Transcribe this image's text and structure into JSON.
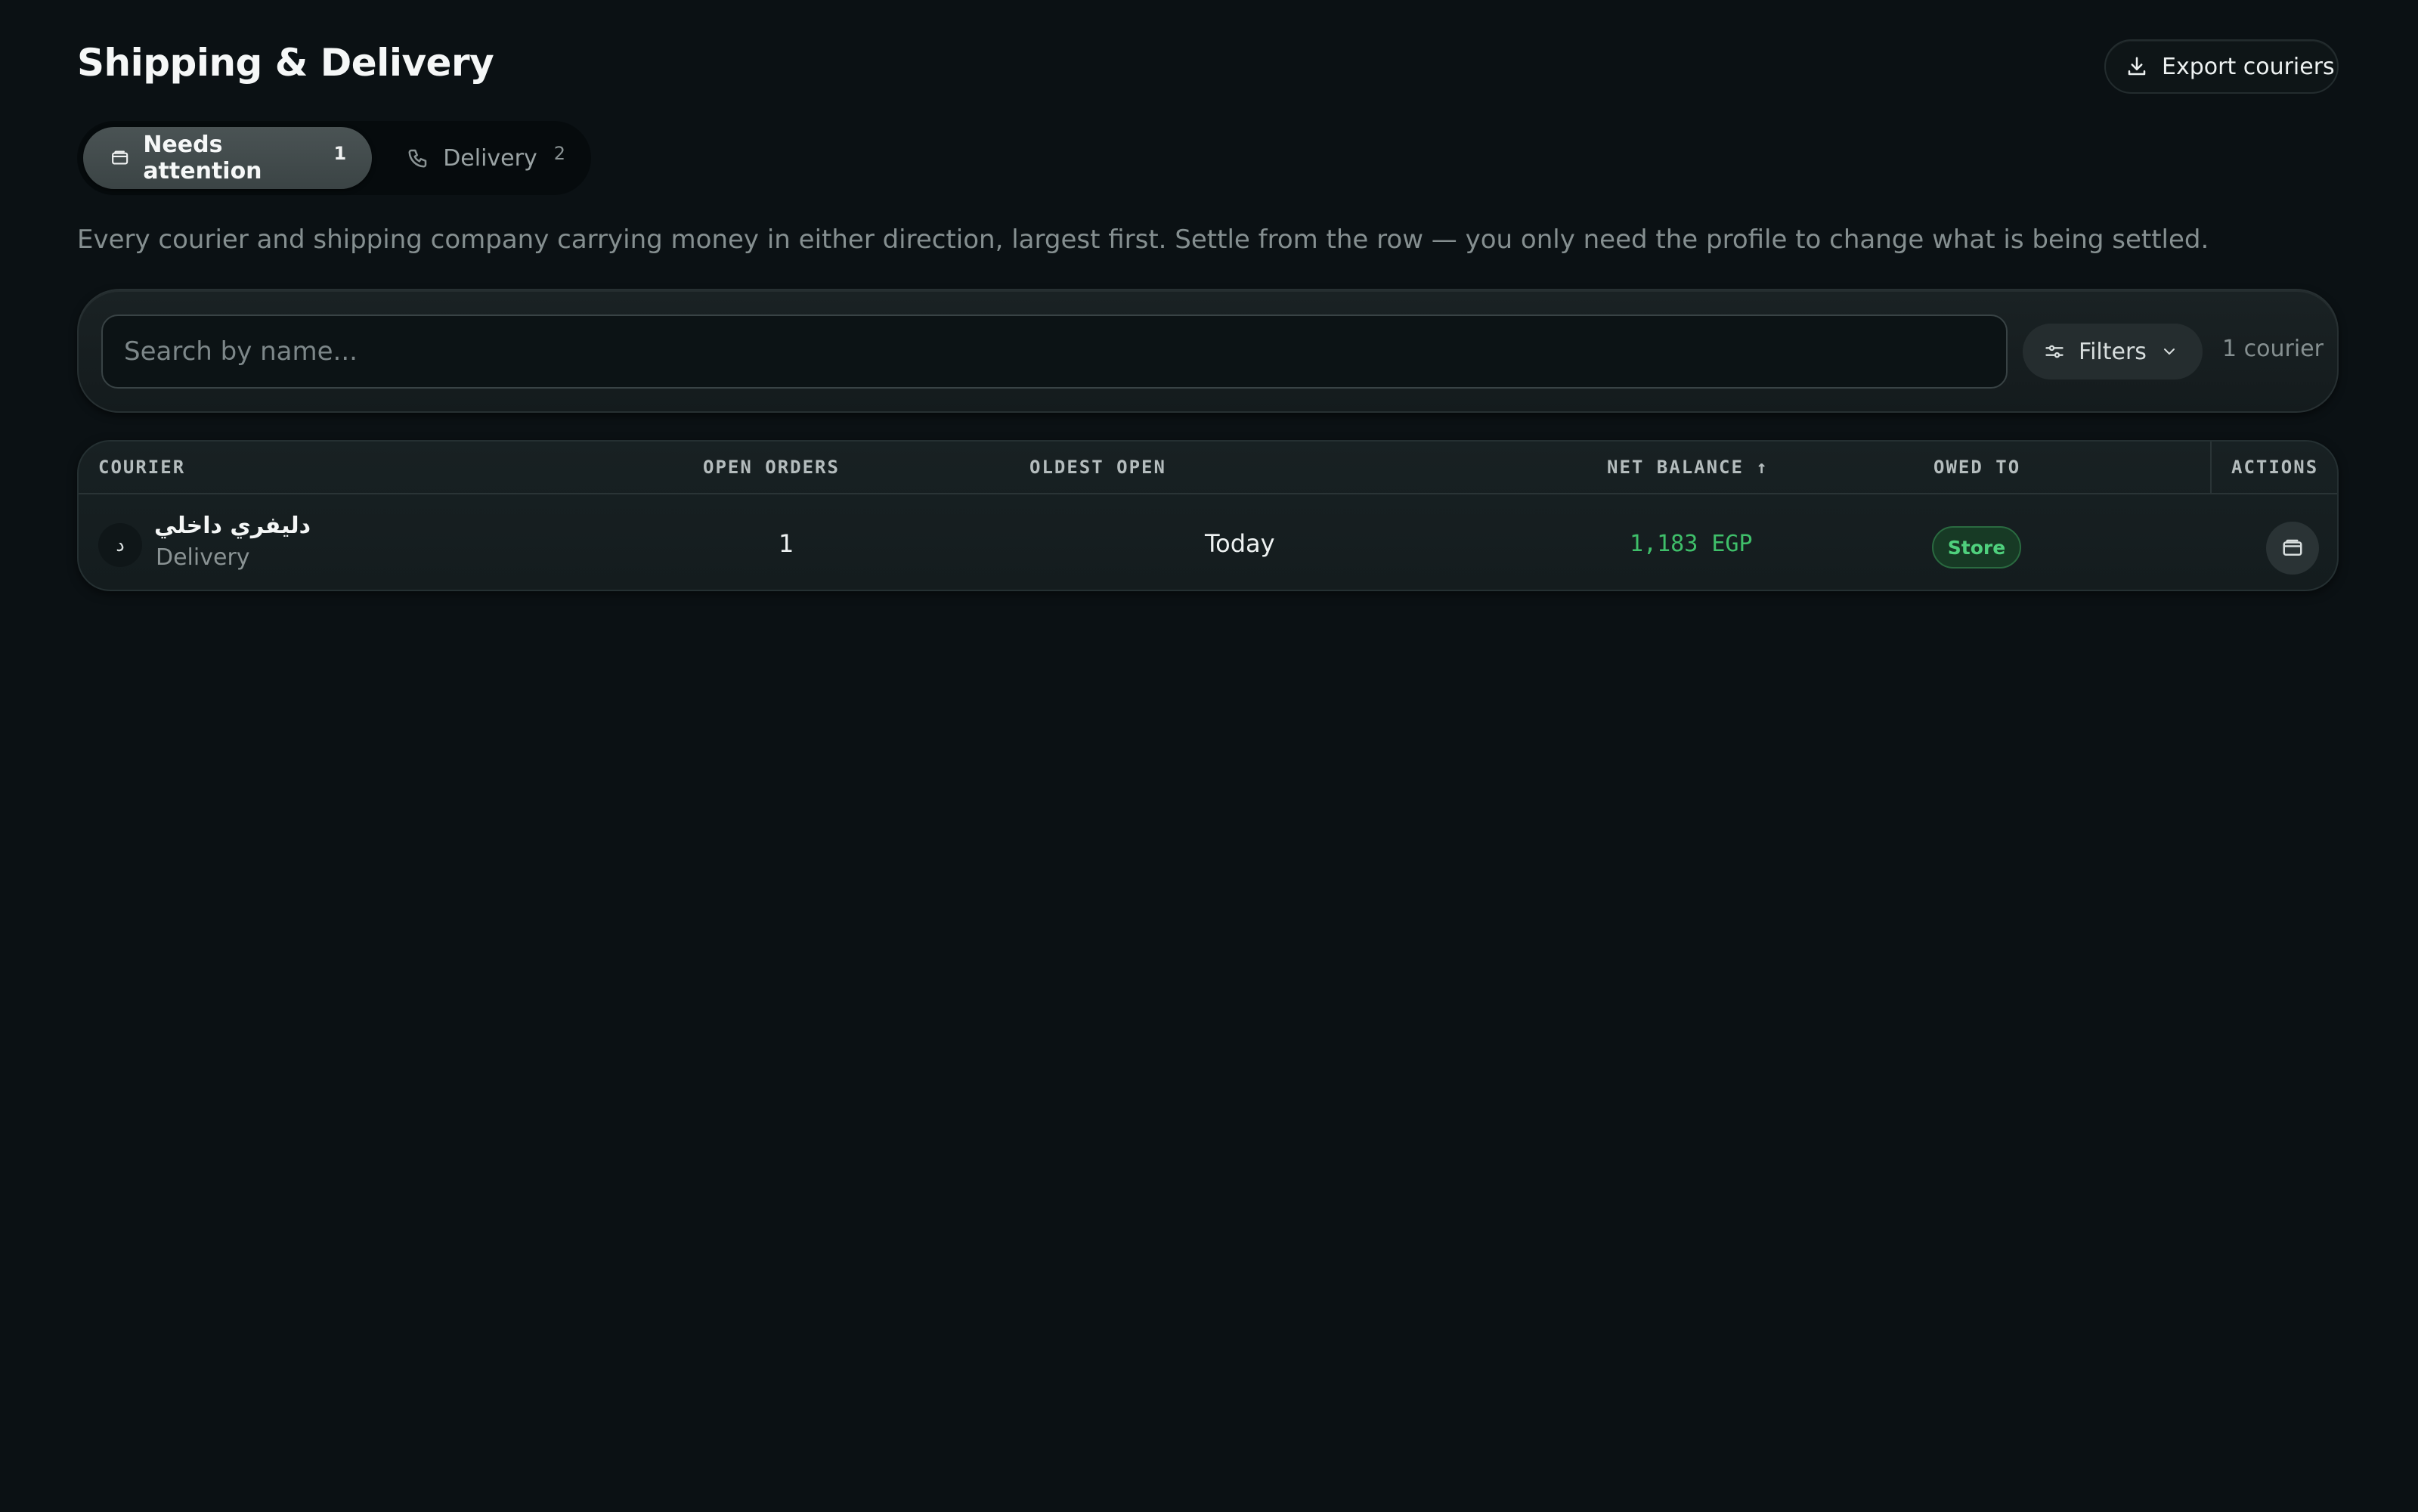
{
  "header": {
    "title": "Shipping & Delivery",
    "export_label": "Export couriers",
    "export_icon": "download-icon"
  },
  "tabs": [
    {
      "label": "Needs attention",
      "count": "1",
      "icon": "wallet-icon",
      "active": true
    },
    {
      "label": "Delivery",
      "count": "2",
      "icon": "phone-icon",
      "active": false
    }
  ],
  "description": "Every courier and shipping company carrying money in either direction, largest first. Settle from the row — you only need the profile to change what is being settled.",
  "search": {
    "placeholder": "Search by name...",
    "value": ""
  },
  "filters": {
    "label": "Filters",
    "icon": "sliders-icon"
  },
  "result_count": "1 courier",
  "table": {
    "columns": {
      "courier": "COURIER",
      "open_orders": "OPEN ORDERS",
      "oldest_open": "OLDEST OPEN",
      "net_balance": "NET BALANCE ↑",
      "owed_to": "OWED TO",
      "actions": "ACTIONS"
    },
    "rows": [
      {
        "avatar": "د",
        "name": "دليفري داخلي",
        "type": "Delivery",
        "open_orders": "1",
        "oldest_open": "Today",
        "net_balance": "1,183 EGP",
        "owed_to": "Store",
        "action_icon": "wallet-icon"
      }
    ]
  },
  "colors": {
    "background": "#0b1114",
    "accent_positive": "#3fbf6a",
    "badge_bg": "#173a25"
  }
}
